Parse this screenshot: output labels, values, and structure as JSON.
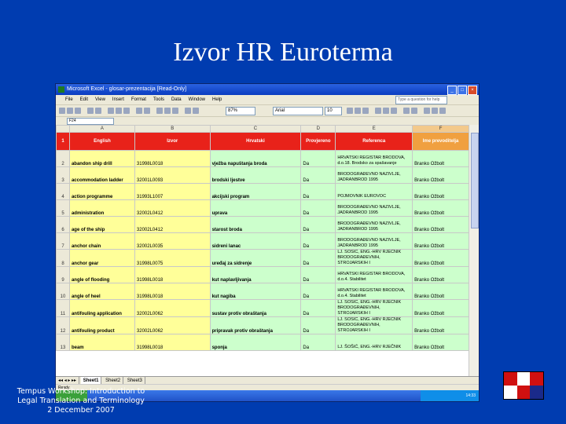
{
  "slide": {
    "title": "Izvor HR Euroterma",
    "footer_line1": "Tempus Workshop: Introduction to",
    "footer_line2": "Legal Translation and Terminology",
    "footer_line3": "2 December 2007"
  },
  "excel": {
    "window_title": "Microsoft Excel - glosar-prezentacija  [Read-Only]",
    "menu": [
      "File",
      "Edit",
      "View",
      "Insert",
      "Format",
      "Tools",
      "Data",
      "Window",
      "Help"
    ],
    "ask_placeholder": "Type a question for help",
    "zoom": "87%",
    "font_name": "Arial",
    "font_size": "10",
    "name_box": "F24",
    "columns": [
      "A",
      "B",
      "C",
      "D",
      "E",
      "F"
    ],
    "header_row": {
      "row_num": "1",
      "english": "English",
      "izvor": "Izvor",
      "hrvatski": "Hrvatski",
      "provjereno": "Provjereno",
      "referenca": "Referenca",
      "prevoditelj": "Ime prevoditelja"
    },
    "rows": [
      {
        "num": "2",
        "en": "abandon ship drill",
        "izvor": "31998L0018",
        "hr": "vježba napuštanja broda",
        "prov": "Da",
        "ref": "HRVATSKI REGISTAR BRODOVA, d.o.18. Brodsko za spašavanje",
        "prev": "Branko Ožbolt"
      },
      {
        "num": "3",
        "en": "accommodation ladder",
        "izvor": "32001L0093",
        "hr": "brodski ljestve",
        "prov": "Da",
        "ref": "BRODOGRAĐEVNO NAZIVLJE, JADRANBROD 1995",
        "prev": "Branko Ožbolt"
      },
      {
        "num": "4",
        "en": "action programme",
        "izvor": "31993L1007",
        "hr": "akcijski program",
        "prov": "Da",
        "ref": "POJMOVNIK EUROVOC",
        "prev": "Branko Ožbolt"
      },
      {
        "num": "5",
        "en": "administration",
        "izvor": "32002L0412",
        "hr": "uprava",
        "prov": "Da",
        "ref": "BRODOGRAĐEVNO NAZIVLJE, JADRANBROD 1995",
        "prev": "Branko Ožbolt"
      },
      {
        "num": "6",
        "en": "age of the ship",
        "izvor": "32002L0412",
        "hr": "starost broda",
        "prov": "Da",
        "ref": "BRODOGRAĐEVNO NAZIVLJE, JADRANBROD 1995",
        "prev": "Branko Ožbolt"
      },
      {
        "num": "7",
        "en": "anchor chain",
        "izvor": "32002L0035",
        "hr": "sidreni lanac",
        "prov": "Da",
        "ref": "BRODOGRAĐEVNO NAZIVLJE, JADRANBROD 1995",
        "prev": "Branko Ožbolt"
      },
      {
        "num": "8",
        "en": "anchor gear",
        "izvor": "31998L0075",
        "hr": "uređaj za sidrenje",
        "prov": "Da",
        "ref": "LJ. ŠOŠIĆ, ENG.-HRV RJEČNIK BRODOGRAĐEVNIH, STROJARSKIH I",
        "prev": "Branko Ožbolt"
      },
      {
        "num": "9",
        "en": "angle of flooding",
        "izvor": "31998L0018",
        "hr": "kut naplavljivanja",
        "prov": "Da",
        "ref": "HRVATSKI REGISTAR BRODOVA, d.o.4. Stabilitet",
        "prev": "Branko Ožbolt"
      },
      {
        "num": "10",
        "en": "angle of heel",
        "izvor": "31998L0018",
        "hr": "kut nagiba",
        "prov": "Da",
        "ref": "HRVATSKI REGISTAR BRODOVA, d.o.4. Stabilitet",
        "prev": "Branko Ožbolt"
      },
      {
        "num": "11",
        "en": "antifouling application",
        "izvor": "32002L0062",
        "hr": "sustav protiv obraštanja",
        "prov": "Da",
        "ref": "LJ. ŠOŠIĆ, ENG.-HRV RJEČNIK BRODOGRAĐEVNIH, STROJARSKIH I",
        "prev": "Branko Ožbolt"
      },
      {
        "num": "12",
        "en": "antifouling product",
        "izvor": "32002L0062",
        "hr": "pripravak protiv obraštanja",
        "prov": "Da",
        "ref": "LJ. ŠOŠIĆ, ENG.-HRV RJEČNIK BRODOGRAĐEVNIH, STROJARSKIH I",
        "prev": "Branko Ožbolt"
      },
      {
        "num": "13",
        "en": "beam",
        "izvor": "31998L0018",
        "hr": "sponja",
        "prov": "Da",
        "ref": "LJ. ŠOŠIĆ, ENG.-HRV RJEČNIK",
        "prev": "Branko Ožbolt"
      }
    ],
    "sheet_tabs": [
      "Sheet1",
      "Sheet2",
      "Sheet3"
    ],
    "status": "Ready",
    "tray_lang": "HR",
    "tray_time": "14:33"
  }
}
